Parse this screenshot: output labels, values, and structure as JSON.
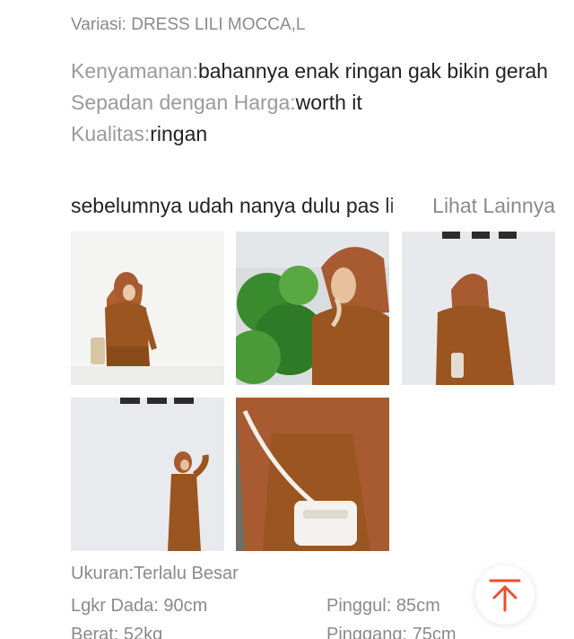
{
  "review": {
    "variant": "Variasi: DRESS LILI MOCCA,L",
    "attributes": [
      {
        "label": "Kenyamanan:",
        "value": "bahannya enak ringan gak bikin gerah"
      },
      {
        "label": "Sepadan dengan Harga:",
        "value": "worth it"
      },
      {
        "label": "Kualitas:",
        "value": "ringan"
      }
    ],
    "preview_text": "sebelumnya udah nanya dulu pas li",
    "see_more": "Lihat Lainnya",
    "photos": [
      {
        "name": "review-photo-1"
      },
      {
        "name": "review-photo-2"
      },
      {
        "name": "review-photo-3"
      },
      {
        "name": "review-photo-4"
      },
      {
        "name": "review-photo-5"
      }
    ],
    "size_note": "Ukuran:Terlalu Besar",
    "measurements": {
      "chest": "Lgkr Dada: 90cm",
      "hip": "Pinggul: 85cm",
      "weight": "Berat: 52kg",
      "waist": "Pinggang: 75cm"
    }
  },
  "scroll_top_button": {
    "icon": "arrow-up-to-top-icon",
    "color": "#ee4d2d"
  },
  "colors": {
    "label_gray": "#9a9a9a",
    "text": "#222222",
    "dress_brown": "#9a5520",
    "hijab_rust": "#a85a30"
  }
}
